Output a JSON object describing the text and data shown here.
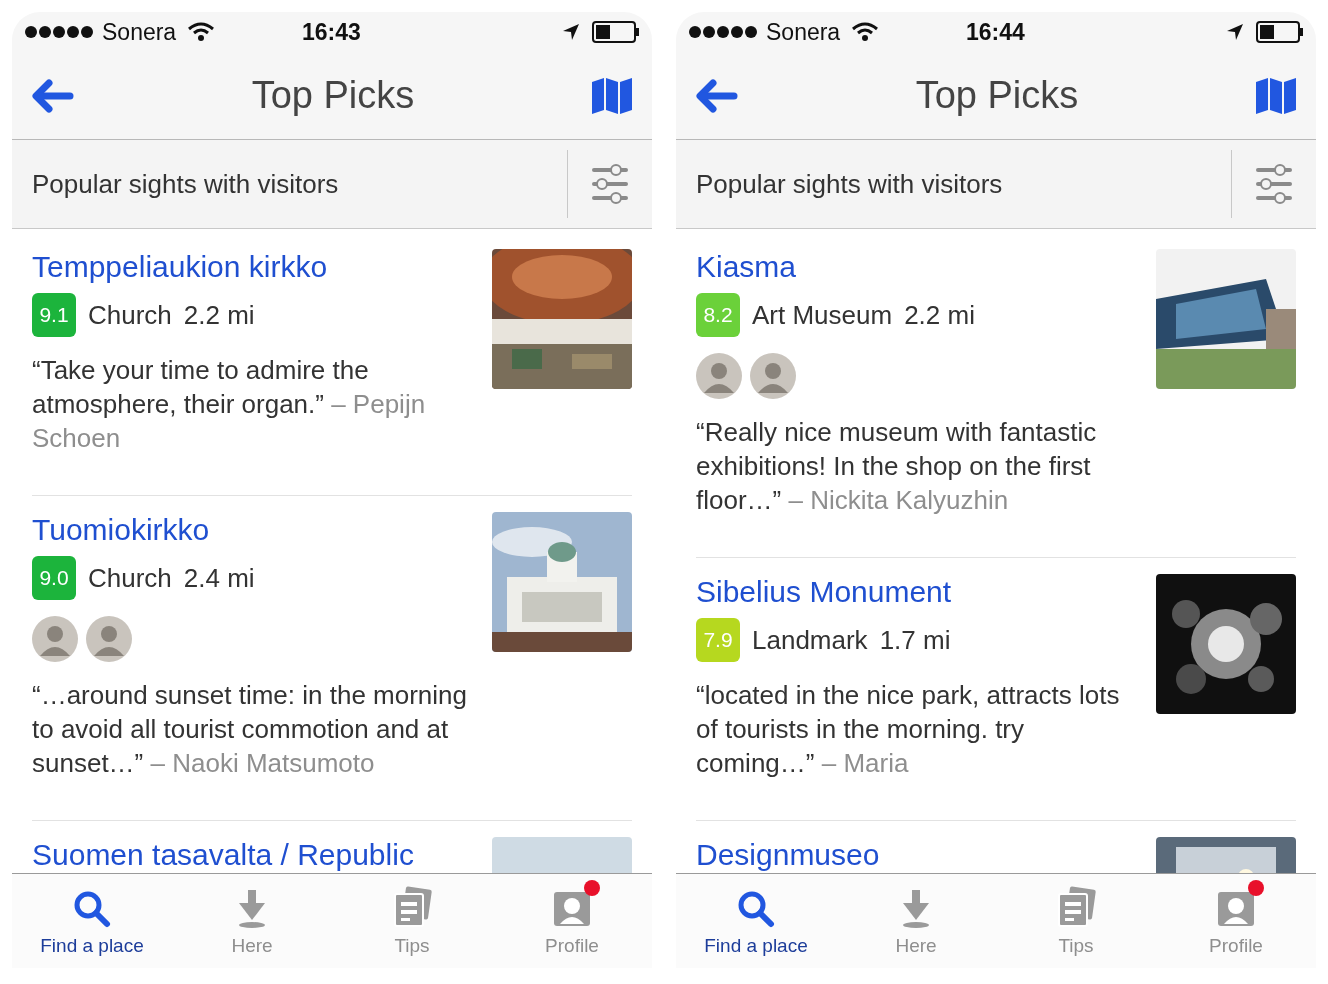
{
  "phones": [
    {
      "status_bar": {
        "carrier": "Sonera",
        "time": "16:43"
      },
      "nav": {
        "title": "Top Picks"
      },
      "filter": {
        "label": "Popular sights with visitors"
      },
      "places": [
        {
          "name": "Temppeliaukion kirkko",
          "score": "9.1",
          "color": "#1cb43c",
          "category": "Church",
          "distance": "2.2 mi",
          "quote": "“Take your time to admire the atmosphere, their organ.”",
          "author": "– Pepijn Schoen"
        },
        {
          "name": "Tuomiokirkko",
          "score": "9.0",
          "color": "#1cb43c",
          "category": "Church",
          "distance": "2.4 mi",
          "avatars": [
            {
              "kind": "avatar"
            },
            {
              "kind": "avatar"
            }
          ],
          "quote": "“…around sunset time: in the morning to avoid all tourist commotion and at sunset…”",
          "author": "– Naoki Matsumoto"
        },
        {
          "name": "Suomen tasavalta / Republic"
        }
      ],
      "tabs": [
        {
          "label": "Find a place",
          "kind": "search",
          "selected": true,
          "notification": false
        },
        {
          "label": "Here",
          "kind": "here",
          "selected": false,
          "notification": false
        },
        {
          "label": "Tips",
          "kind": "tips",
          "selected": false,
          "notification": false
        },
        {
          "label": "Profile",
          "kind": "profile",
          "selected": false,
          "notification": true
        }
      ]
    },
    {
      "status_bar": {
        "carrier": "Sonera",
        "time": "16:44"
      },
      "nav": {
        "title": "Top Picks"
      },
      "filter": {
        "label": "Popular sights with visitors"
      },
      "places": [
        {
          "name": "Kiasma",
          "score": "8.2",
          "color": "#6bd13a",
          "category": "Art Museum",
          "distance": "2.2 mi",
          "avatars": [
            {
              "kind": "avatar"
            },
            {
              "kind": "avatar"
            }
          ],
          "quote": "“Really nice museum with fantastic exhibitions! In the shop on the first floor…”",
          "author": "– Nickita Kalyuzhin"
        },
        {
          "name": "Sibelius Monument",
          "score": "7.9",
          "color": "#b6d81f",
          "category": "Landmark",
          "distance": "1.7 mi",
          "quote": "“located in the nice park, attracts lots of tourists in the morning. try coming…”",
          "author": "– Maria"
        },
        {
          "name": "Designmuseo"
        }
      ],
      "tabs": [
        {
          "label": "Find a place",
          "kind": "search",
          "selected": true,
          "notification": false
        },
        {
          "label": "Here",
          "kind": "here",
          "selected": false,
          "notification": false
        },
        {
          "label": "Tips",
          "kind": "tips",
          "selected": false,
          "notification": false
        },
        {
          "label": "Profile",
          "kind": "profile",
          "selected": false,
          "notification": true
        }
      ]
    }
  ]
}
